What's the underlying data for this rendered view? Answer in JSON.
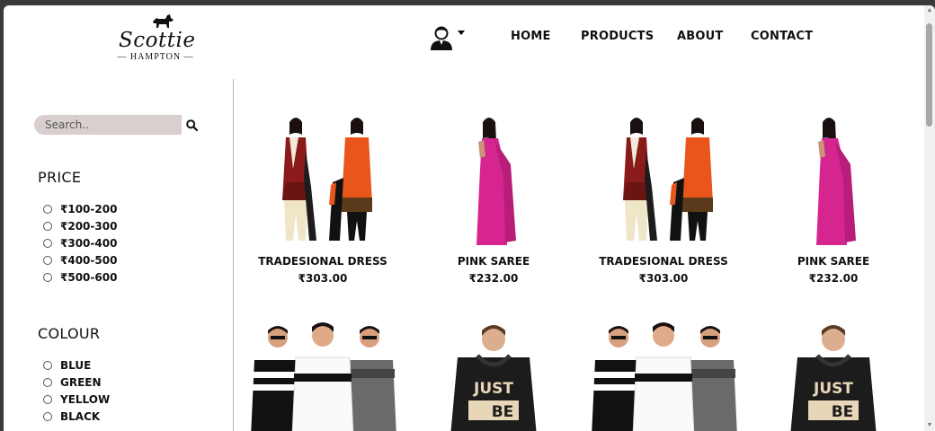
{
  "brand": {
    "name": "Scottie",
    "tagline": "HAMPTON"
  },
  "nav": [
    "HOME",
    "PRODUCTS",
    "ABOUT",
    "CONTACT"
  ],
  "search": {
    "placeholder": "Search.."
  },
  "filters": {
    "price": {
      "title": "PRICE",
      "options": [
        "₹100-200",
        "₹200-300",
        "₹300-400",
        "₹400-500",
        "₹500-600"
      ]
    },
    "colour": {
      "title": "COLOUR",
      "options": [
        "BLUE",
        "GREEN",
        "YELLOW",
        "BLACK"
      ]
    }
  },
  "products": [
    {
      "name": "TRADESIONAL DRESS",
      "price": "₹303.00",
      "image": "two-women-salwar-suits"
    },
    {
      "name": "PINK SAREE",
      "price": "₹232.00",
      "image": "woman-pink-saree"
    },
    {
      "name": "TRADESIONAL DRESS",
      "price": "₹303.00",
      "image": "two-women-salwar-suits"
    },
    {
      "name": "PINK SAREE",
      "price": "₹232.00",
      "image": "woman-pink-saree"
    },
    {
      "name": "",
      "price": "",
      "image": "three-men-striped-tshirts"
    },
    {
      "name": "",
      "price": "",
      "image": "man-black-hoodie"
    },
    {
      "name": "",
      "price": "",
      "image": "three-men-striped-tshirts"
    },
    {
      "name": "",
      "price": "",
      "image": "man-black-hoodie"
    }
  ],
  "colors": {
    "accent": "#d9cfcf",
    "text": "#111111",
    "saree": "#d6258f",
    "suit_red": "#8b1a1a",
    "suit_orange": "#e8561b"
  }
}
